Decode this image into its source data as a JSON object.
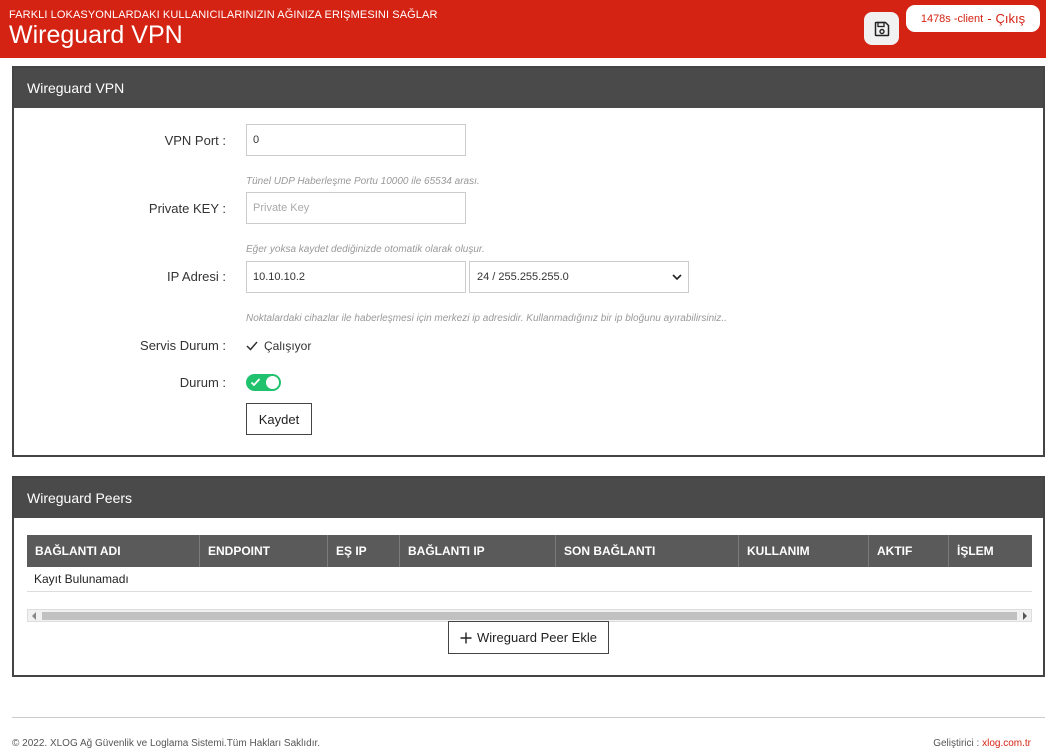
{
  "header": {
    "subtitle": "FARKLI LOKASYONLARDAKI KULLANICILARINIZIN AĞINIZA ERIŞMESINI SAĞLAR",
    "title": "Wireguard VPN",
    "save_icon": "save-icon",
    "user": "1478s -client",
    "separator": "-",
    "logout": "Çıkış",
    "accent_color": "#d42213"
  },
  "vpn_panel": {
    "title": "Wireguard VPN",
    "port_label": "VPN Port :",
    "port_value": "0",
    "port_hint": "Tünel UDP Haberleşme Portu 10000 ile 65534 arası.",
    "key_label": "Private KEY :",
    "key_placeholder": "Private Key",
    "key_hint": "Eğer yoksa kaydet dediğinizde otomatik olarak oluşur.",
    "ip_label": "IP Adresi :",
    "ip_value": "10.10.10.2",
    "mask_value": "24 / 255.255.255.0",
    "ip_hint": "Noktalardaki cihazlar ile haberleşmesi için merkezi ip adresidir. Kullanmadığınız bir ip bloğunu ayırabilirsiniz..",
    "service_label": "Servis Durum :",
    "service_value": "Çalışıyor",
    "state_label": "Durum :",
    "state_on": true,
    "save_label": "Kaydet"
  },
  "peers_panel": {
    "title": "Wireguard Peers",
    "columns": [
      "BAĞLANTI ADI",
      "ENDPOINT",
      "EŞ IP",
      "BAĞLANTI IP",
      "SON BAĞLANTI",
      "KULLANIM",
      "AKTIF",
      "İŞLEM"
    ],
    "empty_text": "Kayıt Bulunamadı",
    "add_label": "Wireguard Peer Ekle"
  },
  "footer": {
    "copyright": "© 2022. XLOG Ağ Güvenlik ve Loglama Sistemi.Tüm Hakları Saklıdır.",
    "developer_label": "Geliştirici :",
    "developer_link": "xlog.com.tr"
  }
}
